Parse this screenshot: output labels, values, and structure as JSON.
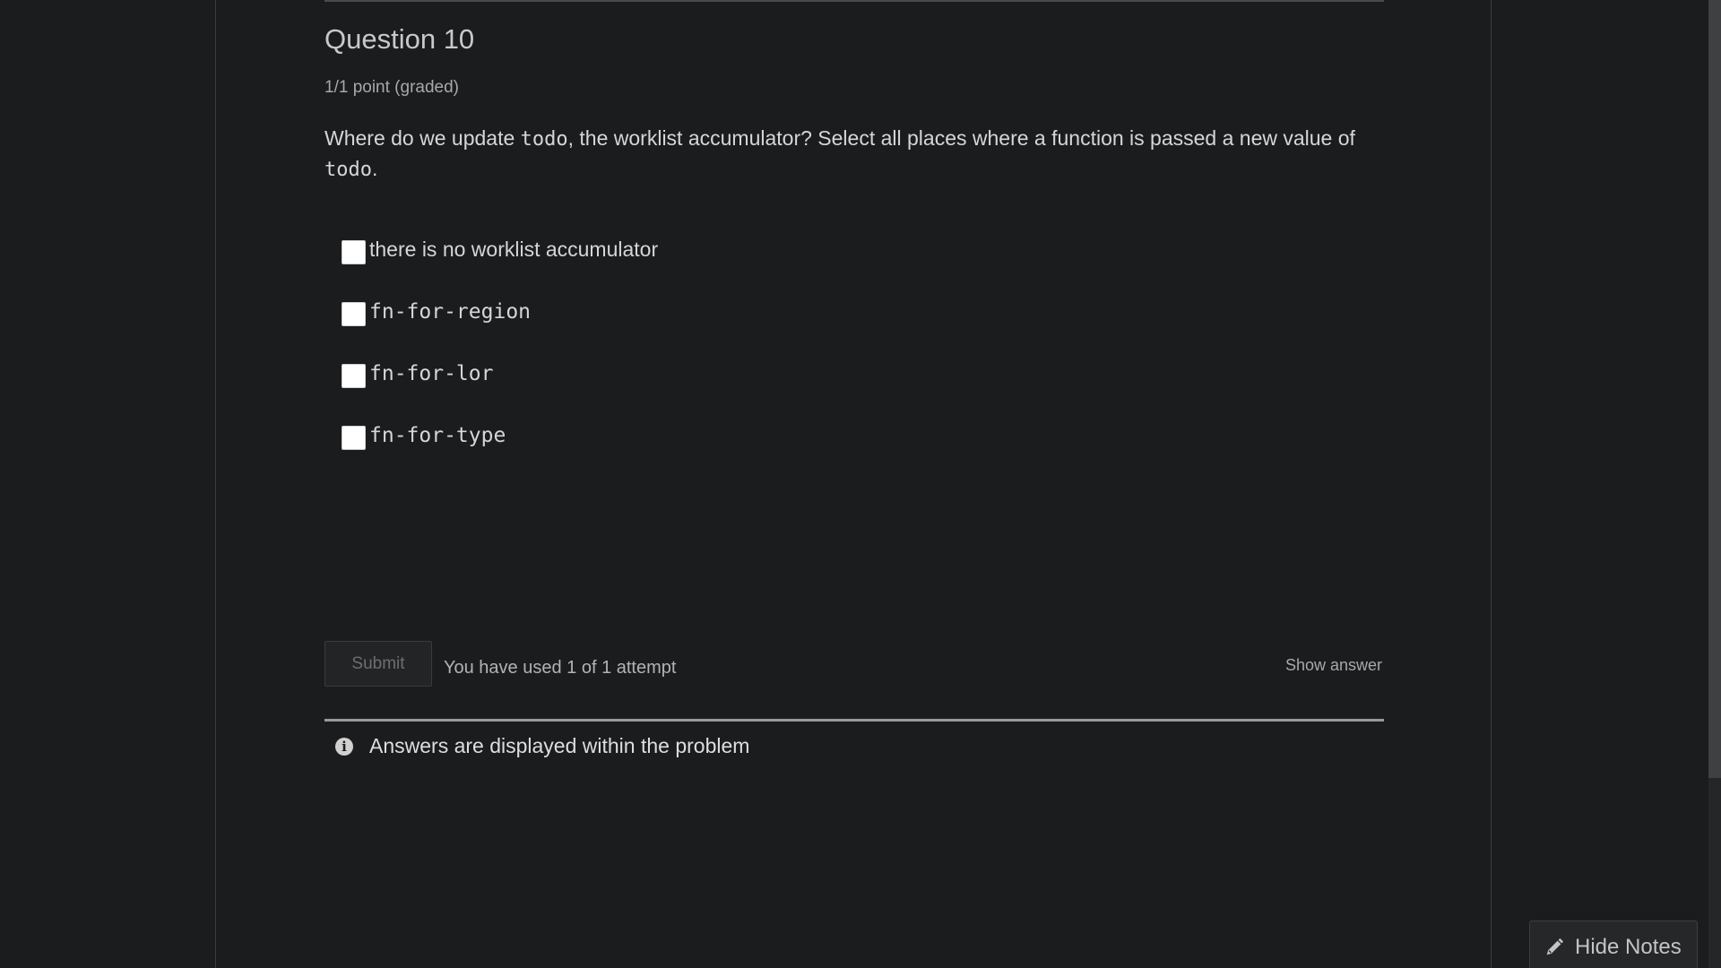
{
  "problem": {
    "title": "Question 10",
    "points": "1/1 point (graded)",
    "prompt": {
      "part1": "Where do we update ",
      "code1": "todo",
      "part2": ", the worklist accumulator? Select all places where a function is passed a new value of ",
      "code2": "todo",
      "part3": "."
    },
    "choices": [
      {
        "label": "there is no worklist accumulator",
        "checked": false
      },
      {
        "label": "fn-for-region",
        "checked": false
      },
      {
        "label": "fn-for-lor",
        "checked": false
      },
      {
        "label": "fn-for-type",
        "checked": false
      }
    ]
  },
  "actions": {
    "submit_label": "Submit",
    "attempts_text": "You have used 1 of 1 attempt",
    "show_answer_label": "Show answer"
  },
  "notice": {
    "icon": "info-icon",
    "text": "Answers are displayed within the problem"
  },
  "notes": {
    "icon": "pencil-icon",
    "label": "Hide Notes"
  }
}
